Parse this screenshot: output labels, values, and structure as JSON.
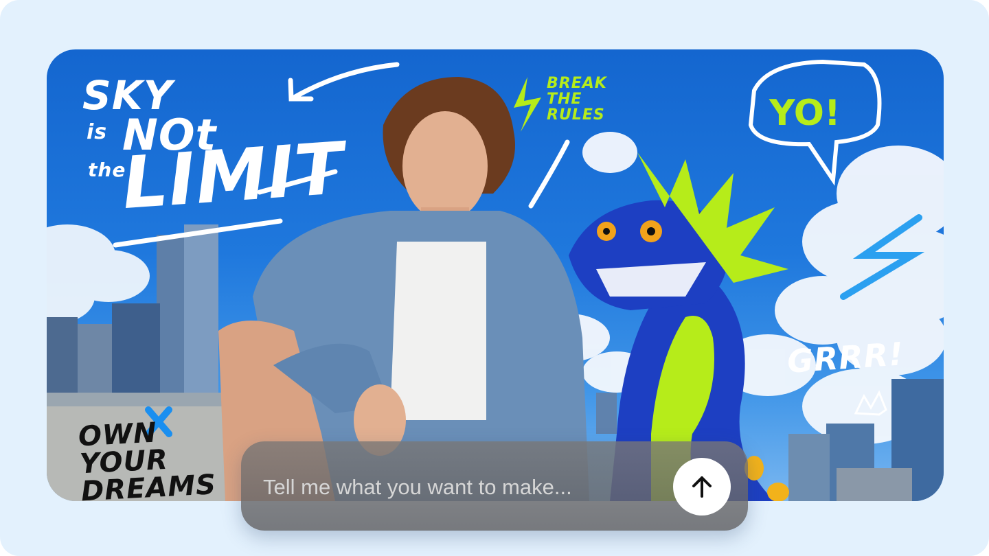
{
  "hero": {
    "graffiti": {
      "sky": "SKY",
      "is": "is",
      "not": "NOt",
      "the": "the",
      "limit": "LIMIT",
      "break_the_rules": "BREAK THE RULES",
      "yo": "YO!",
      "grrr": "GRRR!",
      "own_your_dreams": "OWN YOUR DREAMS"
    },
    "colors": {
      "sky": "#1f78dd",
      "accent_green": "#b6ec1a",
      "dragon_blue": "#1d3fc2"
    }
  },
  "prompt": {
    "placeholder": "Tell me what you want to make...",
    "value": "",
    "send_icon": "arrow-up-icon"
  }
}
